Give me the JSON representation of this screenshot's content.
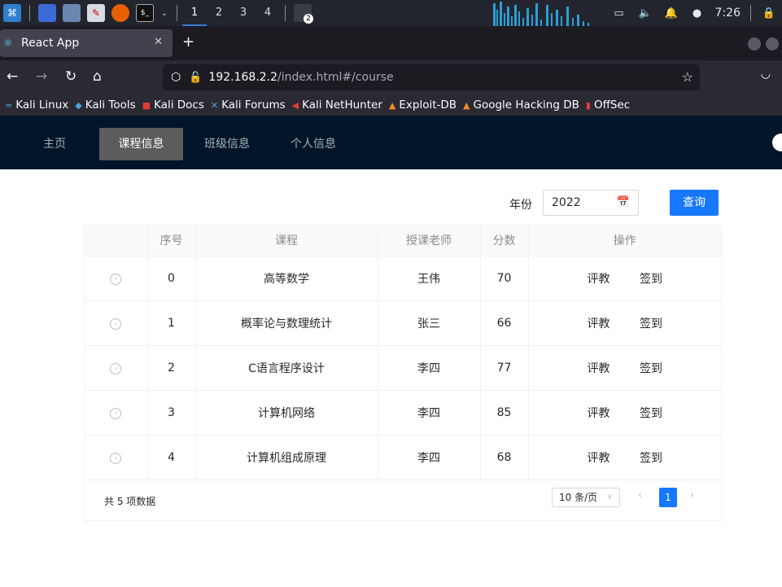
{
  "taskbar": {
    "workspaces": [
      "1",
      "2",
      "3",
      "4"
    ],
    "clock": "7:26",
    "badge": "2"
  },
  "browser": {
    "tab_title": "React App",
    "url_host": "192.168.2.2",
    "url_path": "/index.html#/course",
    "bookmarks": [
      "Kali Linux",
      "Kali Tools",
      "Kali Docs",
      "Kali Forums",
      "Kali NetHunter",
      "Exploit-DB",
      "Google Hacking DB",
      "OffSec"
    ]
  },
  "app": {
    "menu": [
      "主页",
      "课程信息",
      "班级信息",
      "个人信息"
    ],
    "active_menu": "课程信息",
    "year_label": "年份",
    "year_value": "2022",
    "query_label": "查询",
    "table": {
      "headers": [
        "",
        "序号",
        "课程",
        "授课老师",
        "分数",
        "操作"
      ],
      "rows": [
        {
          "index": "0",
          "course": "高等数学",
          "teacher": "王伟",
          "score": "70"
        },
        {
          "index": "1",
          "course": "概率论与数理统计",
          "teacher": "张三",
          "score": "66"
        },
        {
          "index": "2",
          "course": "C语言程序设计",
          "teacher": "李四",
          "score": "77"
        },
        {
          "index": "3",
          "course": "计算机网络",
          "teacher": "李四",
          "score": "85"
        },
        {
          "index": "4",
          "course": "计算机组成原理",
          "teacher": "李四",
          "score": "68"
        }
      ],
      "actions": [
        "评教",
        "签到"
      ]
    },
    "pagination": {
      "total": "共 5 项数据",
      "page_size": "10 条/页",
      "current_page": "1"
    }
  },
  "colors": {
    "header_bg": "#001529",
    "primary": "#1677ff"
  }
}
